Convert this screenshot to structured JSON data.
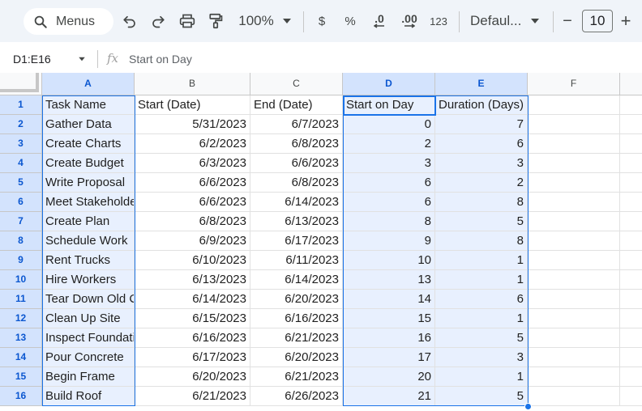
{
  "toolbar": {
    "menus_label": "Menus",
    "zoom": "100%",
    "currency": "$",
    "percent": "%",
    "decrease_decimal": ".0",
    "increase_decimal": ".00",
    "number_format": "123",
    "font": "Defaul...",
    "font_size": "10",
    "minus": "−",
    "plus": "+"
  },
  "formula_bar": {
    "name_box": "D1:E16",
    "fx": "fx",
    "content": "Start on Day"
  },
  "columns": [
    "A",
    "B",
    "C",
    "D",
    "E",
    "F"
  ],
  "rows": [
    [
      "Task Name",
      "Start (Date)",
      "End (Date)",
      "Start on Day",
      "Duration (Days)",
      ""
    ],
    [
      "Gather Data",
      "5/31/2023",
      "6/7/2023",
      "0",
      "7",
      ""
    ],
    [
      "Create Charts",
      "6/2/2023",
      "6/8/2023",
      "2",
      "6",
      ""
    ],
    [
      "Create Budget",
      "6/3/2023",
      "6/6/2023",
      "3",
      "3",
      ""
    ],
    [
      "Write Proposal",
      "6/6/2023",
      "6/8/2023",
      "6",
      "2",
      ""
    ],
    [
      "Meet Stakeholders",
      "6/6/2023",
      "6/14/2023",
      "6",
      "8",
      ""
    ],
    [
      "Create Plan",
      "6/8/2023",
      "6/13/2023",
      "8",
      "5",
      ""
    ],
    [
      "Schedule Work",
      "6/9/2023",
      "6/17/2023",
      "9",
      "8",
      ""
    ],
    [
      "Rent Trucks",
      "6/10/2023",
      "6/11/2023",
      "10",
      "1",
      ""
    ],
    [
      "Hire Workers",
      "6/13/2023",
      "6/14/2023",
      "13",
      "1",
      ""
    ],
    [
      "Tear Down Old Construction",
      "6/14/2023",
      "6/20/2023",
      "14",
      "6",
      ""
    ],
    [
      "Clean Up Site",
      "6/15/2023",
      "6/16/2023",
      "15",
      "1",
      ""
    ],
    [
      "Inspect Foundation",
      "6/16/2023",
      "6/21/2023",
      "16",
      "5",
      ""
    ],
    [
      "Pour Concrete",
      "6/17/2023",
      "6/20/2023",
      "17",
      "3",
      ""
    ],
    [
      "Begin Frame",
      "6/20/2023",
      "6/21/2023",
      "20",
      "1",
      ""
    ],
    [
      "Build Roof",
      "6/21/2023",
      "6/26/2023",
      "21",
      "5",
      ""
    ]
  ],
  "colors": {
    "selection_border": "#1a73e8",
    "selection_fill": "#e8f0fe",
    "header_selected": "#d3e3fd"
  }
}
